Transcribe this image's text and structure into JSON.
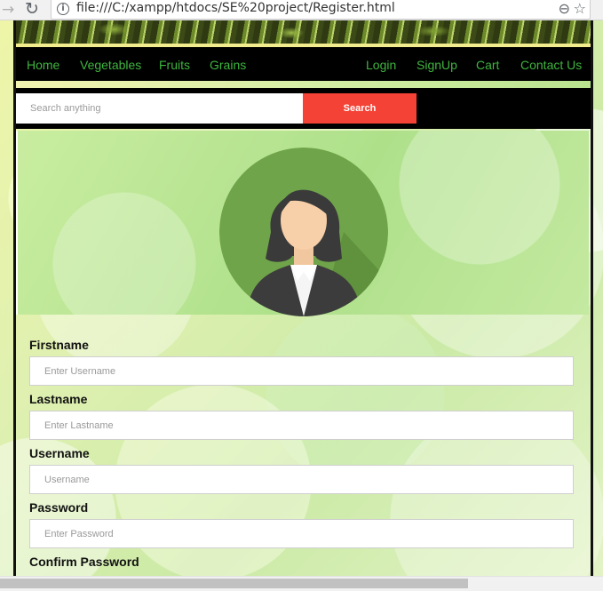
{
  "browser": {
    "url": "file:///C:/xampp/htdocs/SE%20project/Register.html"
  },
  "nav": {
    "left": [
      "Home",
      "Vegetables",
      "Fruits",
      "Grains"
    ],
    "right": [
      "Login",
      "SignUp",
      "Cart",
      "Contact Us"
    ]
  },
  "search": {
    "placeholder": "Search anything",
    "button": "Search"
  },
  "form": {
    "firstname": {
      "label": "Firstname",
      "placeholder": "Enter Username"
    },
    "lastname": {
      "label": "Lastname",
      "placeholder": "Enter Lastname"
    },
    "username": {
      "label": "Username",
      "placeholder": "Username"
    },
    "password": {
      "label": "Password",
      "placeholder": "Enter Password"
    },
    "confirm": {
      "label": "Confirm Password"
    }
  },
  "colors": {
    "nav_link": "#3fb53f",
    "search_button": "#f44336",
    "avatar_bg": "#6fa44a"
  },
  "icons": {
    "back": "back-arrow-icon",
    "reload": "reload-icon",
    "info": "info-icon",
    "zoom": "zoom-out-icon",
    "star": "bookmark-star-icon",
    "avatar": "user-avatar-icon"
  }
}
